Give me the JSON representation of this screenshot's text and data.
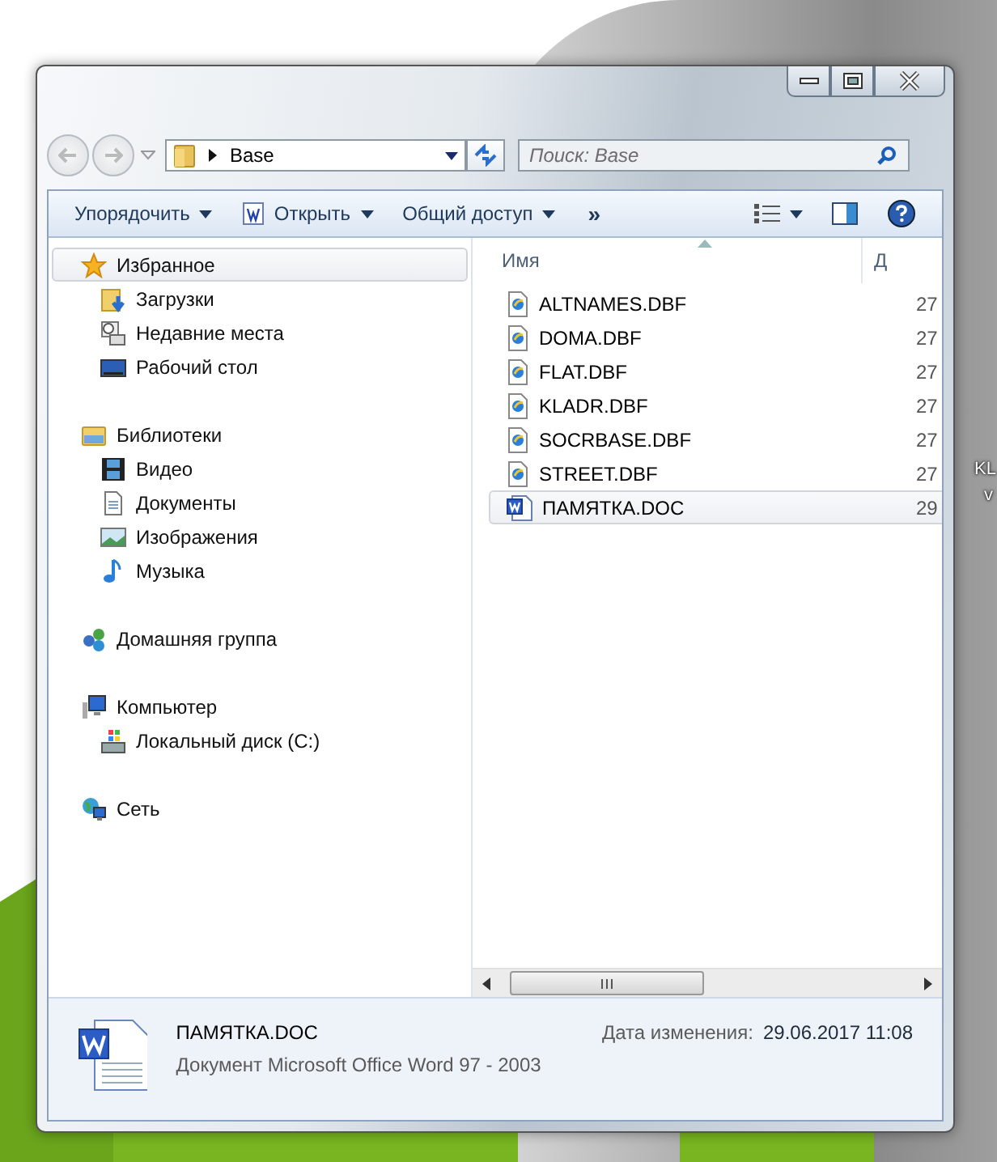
{
  "desktop": {
    "icon_labels": [
      "KL",
      "v"
    ]
  },
  "address": {
    "path": "Base"
  },
  "search": {
    "placeholder": "Поиск: Base"
  },
  "toolbar": [
    {
      "label": "Упорядочить",
      "kind": "menu"
    },
    {
      "label": "Открыть",
      "kind": "open"
    },
    {
      "label": "Общий доступ",
      "kind": "menu"
    },
    {
      "label": "»",
      "kind": "more"
    }
  ],
  "nav": [
    {
      "label": "Избранное",
      "kind": "star",
      "selected": true,
      "children": [
        {
          "label": "Загрузки",
          "kind": "downloads",
          "selected": false
        },
        {
          "label": "Недавние места",
          "kind": "recent",
          "selected": false
        },
        {
          "label": "Рабочий стол",
          "kind": "desktop",
          "selected": false
        }
      ]
    },
    {
      "label": "Библиотеки",
      "kind": "libraries",
      "selected": false,
      "children": [
        {
          "label": "Видео",
          "kind": "video",
          "selected": false
        },
        {
          "label": "Документы",
          "kind": "documents",
          "selected": false
        },
        {
          "label": "Изображения",
          "kind": "pictures",
          "selected": false
        },
        {
          "label": "Музыка",
          "kind": "music",
          "selected": false
        }
      ]
    },
    {
      "label": "Домашняя группа",
      "kind": "homegroup",
      "selected": false
    },
    {
      "label": "Компьютер",
      "kind": "computer",
      "selected": false,
      "children": [
        {
          "label": "Локальный диск (C:)",
          "kind": "disk",
          "selected": false
        }
      ]
    },
    {
      "label": "Сеть",
      "kind": "network",
      "selected": false
    }
  ],
  "files": {
    "columns": [
      "Имя",
      "Д"
    ],
    "rows": [
      {
        "name": "ALTNAMES.DBF",
        "date": "27",
        "kind": "dbf",
        "selected": false
      },
      {
        "name": "DOMA.DBF",
        "date": "27",
        "kind": "dbf",
        "selected": false
      },
      {
        "name": "FLAT.DBF",
        "date": "27",
        "kind": "dbf",
        "selected": false
      },
      {
        "name": "KLADR.DBF",
        "date": "27",
        "kind": "dbf",
        "selected": false
      },
      {
        "name": "SOCRBASE.DBF",
        "date": "27",
        "kind": "dbf",
        "selected": false
      },
      {
        "name": "STREET.DBF",
        "date": "27",
        "kind": "dbf",
        "selected": false
      },
      {
        "name": "ПАМЯТКА.DOC",
        "date": "29",
        "kind": "doc",
        "selected": true
      }
    ]
  },
  "details": {
    "name": "ПАМЯТКА.DOC",
    "type": "Документ Microsoft Office Word 97 - 2003",
    "date_label": "Дата изменения:",
    "date": "29.06.2017 11:08"
  }
}
